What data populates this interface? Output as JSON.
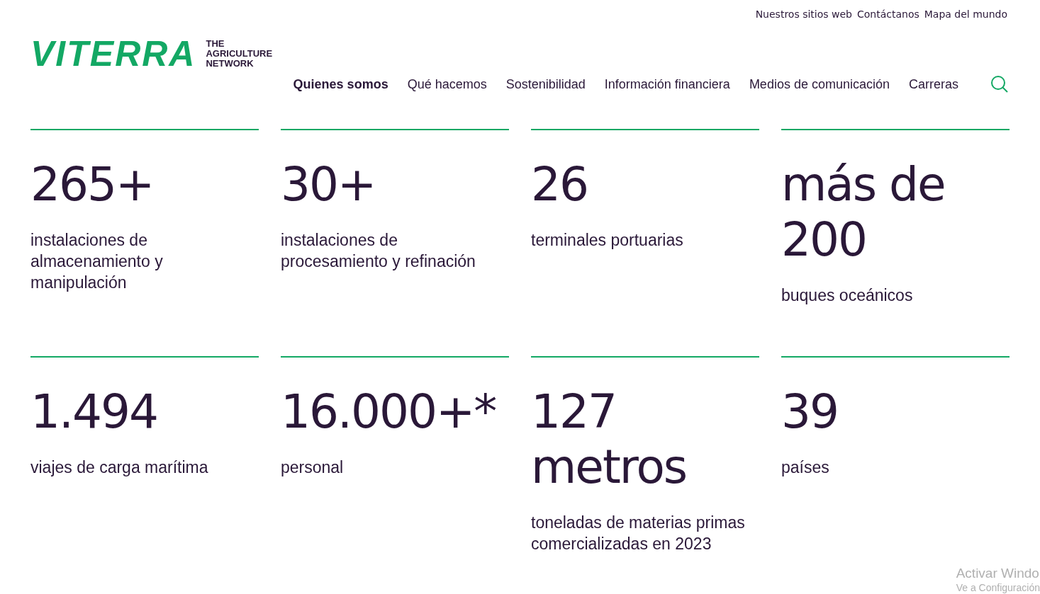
{
  "logo": {
    "wordmark": "VITERRA",
    "tagline": [
      "THE",
      "AGRICULTURE",
      "NETWORK"
    ]
  },
  "utility_links": [
    "Nuestros sitios web",
    "Contáctanos",
    "Mapa del mundo"
  ],
  "nav": [
    {
      "label": "Quienes somos",
      "selected": true
    },
    {
      "label": "Qué hacemos",
      "selected": false
    },
    {
      "label": "Sostenibilidad",
      "selected": false
    },
    {
      "label": "Información financiera",
      "selected": false
    },
    {
      "label": "Medios de comunicación",
      "selected": false
    },
    {
      "label": "Carreras",
      "selected": false
    }
  ],
  "stats": [
    {
      "value": "265+",
      "label": "instalaciones de almacenamiento y manipulación"
    },
    {
      "value": "30+",
      "label": "instalaciones de procesamiento y refinación"
    },
    {
      "value": "26",
      "label": "terminales portuarias"
    },
    {
      "value": "más de 200",
      "label": "buques oceánicos"
    },
    {
      "value": "1.494",
      "label": "viajes de carga marítima"
    },
    {
      "value": "16.000+*",
      "label": "personal"
    },
    {
      "value": "127 metros",
      "label": "toneladas de materias primas comercializadas en 2023"
    },
    {
      "value": "39",
      "label": "países"
    }
  ],
  "os_notice": [
    "Activar Windo",
    "Ve a Configuración"
  ]
}
